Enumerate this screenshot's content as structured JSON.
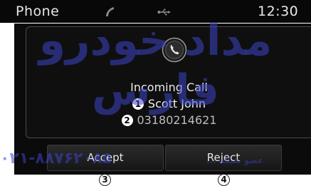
{
  "statusbar": {
    "app_title": "Phone",
    "clock": "12:30",
    "icons": [
      "phone-status-icon",
      "usb-icon"
    ]
  },
  "call": {
    "icon": "incoming-call-icon",
    "status": "Incoming Call",
    "caller_name": "Scott John",
    "caller_number": "03180214621"
  },
  "buttons": {
    "accept_label": "Accept",
    "reject_label": "Reject"
  },
  "markers": {
    "name": "1",
    "number": "2",
    "accept": "3",
    "reject": "4"
  },
  "watermark": {
    "brand": "مداد خودرو فارس",
    "phone": "۰۲۱-۸۸۷۶۲۰۸۵",
    "network": "عضو شبکه ..."
  },
  "colors": {
    "statusbar_bg": "#080808",
    "panel_bg": "#0b0b0b",
    "text": "#ebebeb",
    "watermark": "#3c46c8"
  }
}
